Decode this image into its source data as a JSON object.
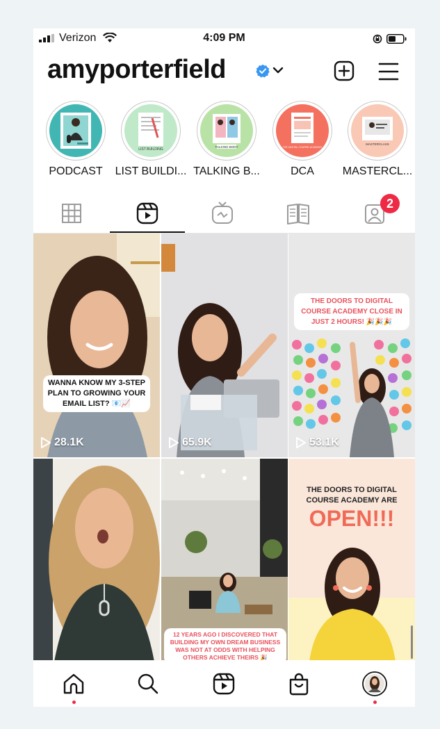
{
  "status_bar": {
    "carrier": "Verizon",
    "time": "4:09 PM"
  },
  "profile": {
    "username": "amyporterfield",
    "verified": true
  },
  "highlights": [
    {
      "label": "PODCAST",
      "bg": "#41b6b3"
    },
    {
      "label": "LIST BUILDI...",
      "bg": "#bfe9c8",
      "cover_text": "LIST BUILDING"
    },
    {
      "label": "TALKING B...",
      "bg": "#b9e3a6",
      "cover_text": "TALKING BODY"
    },
    {
      "label": "DCA",
      "bg": "#f4705f",
      "cover_text": "THE DIGITAL COURSE ACADEMY"
    },
    {
      "label": "MASTERCL...",
      "bg": "#f9c9b5",
      "cover_text": "MASTERCLASS"
    }
  ],
  "tabs": [
    {
      "icon": "grid-icon"
    },
    {
      "icon": "reels-icon",
      "active": true
    },
    {
      "icon": "igtv-icon"
    },
    {
      "icon": "guides-icon"
    },
    {
      "icon": "tagged-icon",
      "badge": "2"
    }
  ],
  "reels": [
    {
      "caption": "WANNA KNOW MY 3-STEP PLAN TO GROWING YOUR EMAIL LIST? 📧📈",
      "views": "28.1K"
    },
    {
      "caption": "",
      "views": "65.9K"
    },
    {
      "caption": "THE DOORS TO DIGITAL COURSE ACADEMY CLOSE IN JUST 2 HOURS! 🎉🎉🎉",
      "views": "53.1K"
    },
    {
      "caption": "",
      "views": ""
    },
    {
      "caption": "12 YEARS AGO I DISCOVERED THAT BUILDING MY OWN DREAM BUSINESS WAS NOT AT ODDS WITH HELPING OTHERS ACHIEVE THEIRS 🎉",
      "views": ""
    },
    {
      "caption": "THE DOORS TO DIGITAL COURSE ACADEMY ARE",
      "headline": "OPEN!!!",
      "views": ""
    }
  ],
  "colors": {
    "accent_red": "#ee2a45",
    "verified_blue": "#3897f0",
    "caption_red": "#e8505b",
    "open_orange": "#f06b57"
  },
  "bottom_nav": [
    {
      "icon": "home-icon",
      "dot": true
    },
    {
      "icon": "search-icon"
    },
    {
      "icon": "reels-icon"
    },
    {
      "icon": "shop-icon"
    },
    {
      "icon": "profile-avatar",
      "dot": true
    }
  ]
}
